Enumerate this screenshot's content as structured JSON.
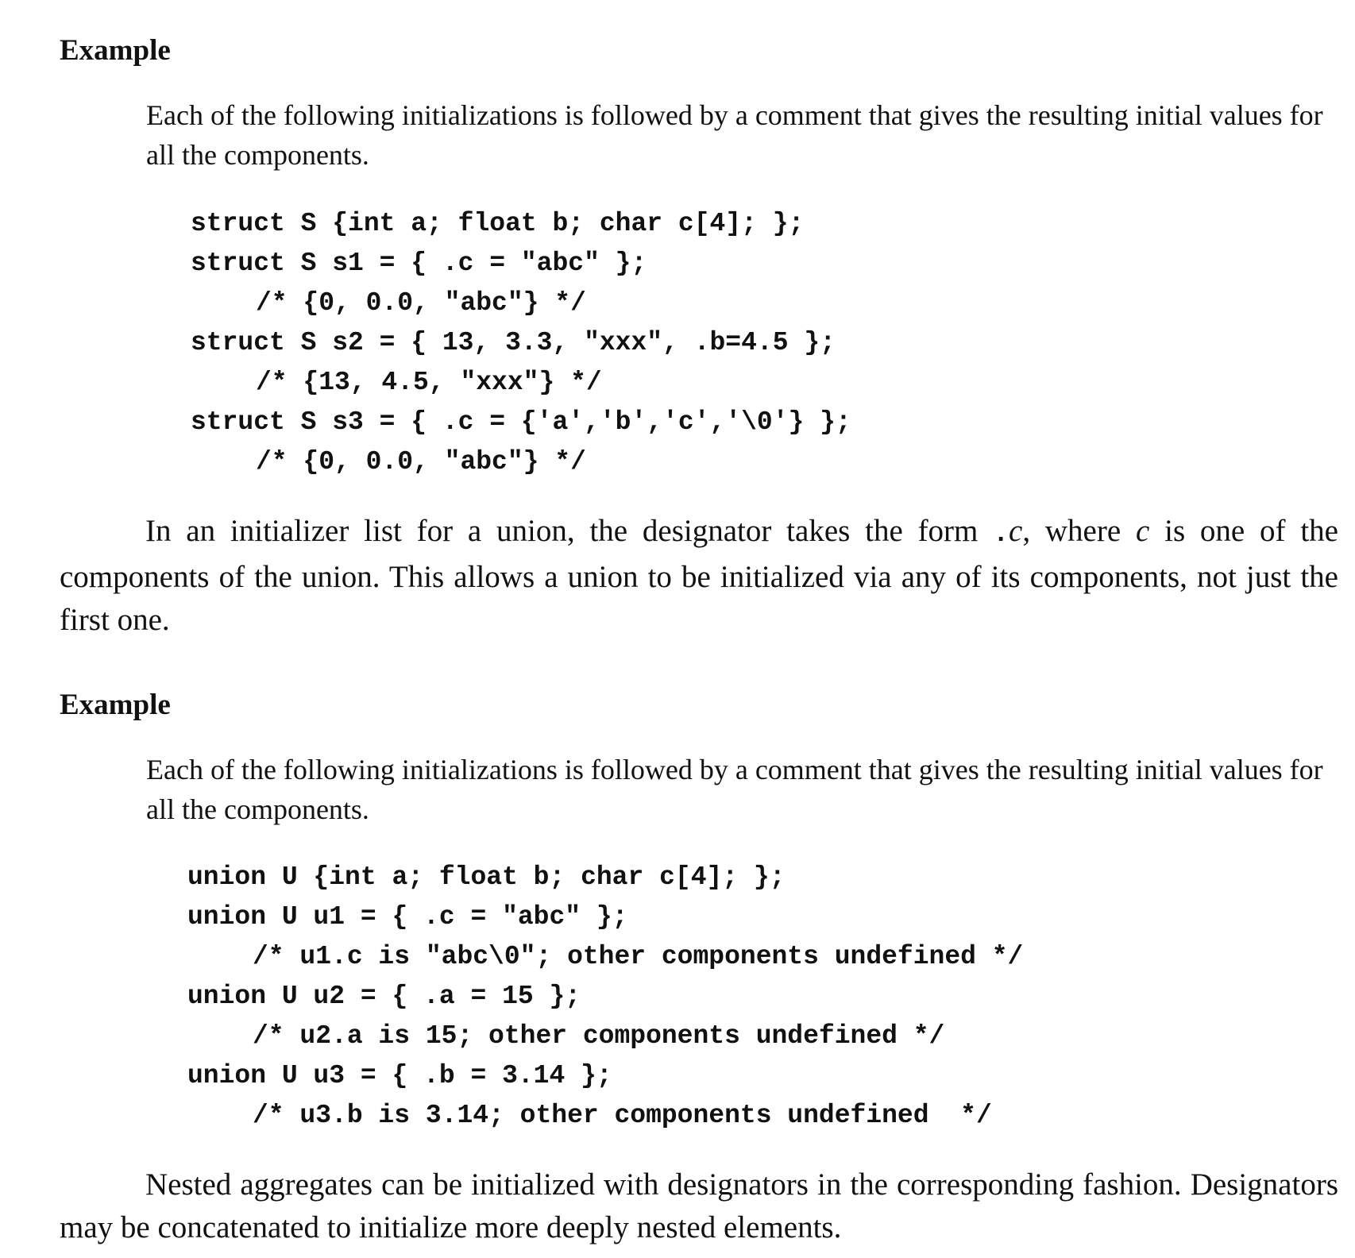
{
  "example1": {
    "heading": "Example",
    "intro": "Each of the following initializations is followed by a comment that gives the resulting initial values for all the components.",
    "code_lines": [
      "struct S {int a; float b; char c[4]; };",
      "struct S s1 = { .c = \"abc\" };",
      "/* {0, 0.0, \"abc\"} */",
      "struct S s2 = { 13, 3.3, \"xxx\", .b=4.5 };",
      "/* {13, 4.5, \"xxx\"} */",
      "struct S s3 = { .c = {'a','b','c','\\0'} };",
      "/* {0, 0.0, \"abc\"} */"
    ]
  },
  "paragraph1": {
    "text_before": "In an initializer list for a union, the designator takes the form ",
    "designator_dot": ".",
    "designator_var": "c",
    "text_middle": ", where ",
    "var_c": "c",
    "text_after": " is one of the components of the union. This allows a union to be initialized via any of its components, not just the first one."
  },
  "example2": {
    "heading": "Example",
    "intro": "Each of the following initializations is followed by a comment that gives the resulting initial values for all the components.",
    "code_lines": [
      "union U {int a; float b; char c[4]; };",
      "union U u1 = { .c = \"abc\" };",
      "/* u1.c is \"abc\\0\"; other components undefined */",
      "union U u2 = { .a = 15 };",
      "/* u2.a is 15; other components undefined */",
      "union U u3 = { .b = 3.14 };",
      "/* u3.b is 3.14; other components undefined  */"
    ]
  },
  "paragraph2": {
    "text": "Nested aggregates can be initialized with designators in the corresponding fashion. Designators may be concatenated to initialize more deeply nested elements."
  }
}
